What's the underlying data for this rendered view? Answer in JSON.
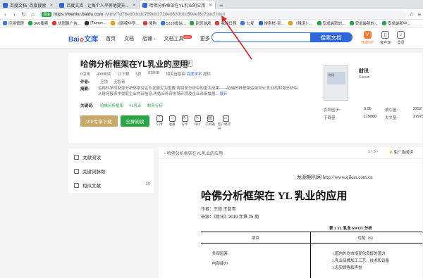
{
  "browser": {
    "tabs": [
      {
        "label": "百度文档_百度搜索",
        "color": "#2f66d8"
      },
      {
        "label": "百度文库 - 让每个人平等地提升...",
        "color": "#2f66d8"
      },
      {
        "label": "哈佛分析框架在YL乳业的应用",
        "color": "#2f66d8",
        "active": true
      }
    ],
    "new_tab": "+",
    "address": {
      "badge": "百度",
      "host": "https://wenku.baidu.com",
      "path": "/view/7d76eb0dcdc789eb172ded630b1c59eef8c79acf.html"
    },
    "bookmarks": [
      {
        "label": "应用管理",
        "color": "#3a7be0"
      },
      {
        "label": "360搜索",
        "color": "#2aa547"
      },
      {
        "label": "优图像广告...",
        "color": "#e23c3c"
      },
      {
        "label": "[Tampe...",
        "color": "#333333"
      },
      {
        "label": "《鹤唳华亭...",
        "color": "#e5a100"
      },
      {
        "label": "搜狗",
        "color": "#e23c3c"
      },
      {
        "label": "5118爱站...",
        "color": "#3a7be0"
      },
      {
        "label": "网页游戏",
        "color": "#2aa547"
      },
      {
        "label": "我的日程",
        "color": "#e23c3c"
      },
      {
        "label": "七麦",
        "color": "#3a7be0"
      },
      {
        "label": "搜索框-百...",
        "color": "#2f66d8"
      },
      {
        "label": "《辣道》...",
        "color": "#e5a100"
      },
      {
        "label": "安卓最新的...",
        "color": "#2aa547"
      },
      {
        "label": "安卓最新的...",
        "color": "#2aa547"
      },
      {
        "label": "安卓最新中...",
        "color": "#2aa547"
      }
    ]
  },
  "site": {
    "logo_text": "Bai",
    "logo_suffix": "文库",
    "nav": [
      "首页",
      "文档",
      "店铺",
      "文档工具",
      "更多"
    ],
    "new_badge": "NEW",
    "search_button": "搜索文档",
    "header_icons": [
      {
        "label": "开通VIP",
        "glyph": "V",
        "icon": "vip-icon"
      },
      {
        "label": "客户端",
        "glyph": "▯",
        "icon": "client-icon"
      },
      {
        "label": "登录",
        "glyph": "○",
        "icon": "user-icon"
      }
    ]
  },
  "doc": {
    "title": "哈佛分析框架在YL乳业的应用",
    "tag": "学术文献",
    "meta": {
      "reads": "0引用",
      "views": "498阅读",
      "downloads": "12下载",
      "pages": "5页",
      "size": "818KB",
      "source_label": "相关信息由",
      "source_link": "百度学术",
      "source_suffix": "提供"
    },
    "author_label": "作者:",
    "authors": [
      "王锁",
      "王智青"
    ],
    "abstract_label": "摘要:",
    "abstract": "运用科学的财务分析体系对企业发展尤为重要,将财务分析中的重大成果——哈佛分析框架运用到YL乳业的财务分析中,从财务报表中提取企业内部信息,再结合外部市场环境及企业未来发展...",
    "abstract_more": "展开",
    "keywords_label": "关键词:",
    "keywords": [
      "哈佛分析框架",
      "YL乳业",
      "财务分析"
    ],
    "btn_vip": "VIP专享下载",
    "btn_read": "全屏阅读",
    "tools": [
      {
        "label": "引用",
        "icon": "cite-icon",
        "glyph": "“"
      },
      {
        "label": "收藏",
        "icon": "star-icon",
        "glyph": "☆"
      },
      {
        "label": "分享",
        "icon": "share-icon",
        "glyph": "⇱"
      },
      {
        "label": "评价",
        "icon": "comment-icon",
        "glyph": "✎"
      },
      {
        "label": "工具箱",
        "icon": "toolbox-icon",
        "glyph": "▤"
      },
      {
        "label": "客户端打开",
        "icon": "client-open-icon",
        "glyph": "▭"
      }
    ],
    "journal": {
      "cover_text": "财讯",
      "name": "财讯",
      "en": "Caixun",
      "stats": [
        {
          "k": "影响因子:",
          "v": "0.05"
        },
        {
          "k": "被引量:",
          "v": "3252"
        },
        {
          "k": "下载量:",
          "v": "119880"
        },
        {
          "k": "发文量:",
          "v": "27973"
        }
      ]
    }
  },
  "sidebar": {
    "items": [
      {
        "label": "文献阅读",
        "icon": "doc-icon"
      },
      {
        "label": "关键词脉数",
        "icon": "chart-icon"
      },
      {
        "label": "相似文献",
        "icon": "similar-icon"
      }
    ],
    "count": "10"
  },
  "viewer": {
    "title": "哈佛分析框架在YL乳业的应用",
    "page": "1 / 5",
    "fullscreen": "免广告阅读",
    "qikan": "龙源期刊网  http://www.qikan.com.cn",
    "paper_title": "哈佛分析框架在 YL 乳业的应用",
    "author": "作者：王锁 王智青",
    "source": "来源：《财讯》2019 年第 25 期",
    "table_caption": "表 1   YL 乳业 SWOT 分析",
    "table_head": [
      "项目",
      "优势（S）"
    ],
    "table_rows": [
      {
        "label": "外部因素",
        "value": "1.国内外均市场变化良好的潜力"
      },
      {
        "label": "内部能力",
        "value": "2.乳业品牌加工工艺、技术和设备"
      },
      {
        "label": "",
        "value": "3.忠实顾客和声誉"
      }
    ]
  }
}
